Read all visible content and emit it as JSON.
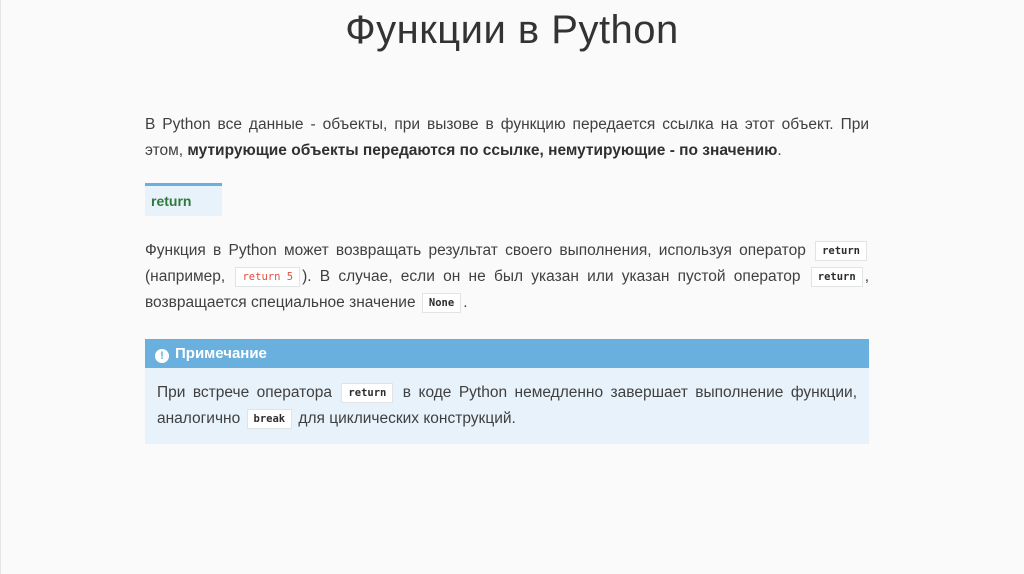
{
  "title": "Функции в Python",
  "intro": {
    "text1": "В Python все данные - объекты, при вызове в функцию передается ссылка на этот объект. При этом, ",
    "bold": "мутирующие объекты передаются по ссылке, немутирующие - по значению",
    "text2": "."
  },
  "return_block": {
    "label": "return"
  },
  "return_desc": {
    "part1": "Функция в Python может возвращать результат своего выполнения, используя оператор ",
    "code1": "return",
    "part2": " (например, ",
    "code2": "return 5",
    "part3": "). В случае, если он не был указан или указан пустой оператор ",
    "code3": "return",
    "part4": ", возвращается специальное значение ",
    "code4": "None",
    "part5": "."
  },
  "note": {
    "icon": "info-icon",
    "icon_glyph": "!",
    "header": "Примечание",
    "part1": "При встрече оператора ",
    "code1": "return",
    "part2": " в коде Python немедленно завершает выполнение функции, аналогично ",
    "code2": "break",
    "part3": " для циклических конструкций."
  },
  "colors": {
    "note_header": "#6ab0de",
    "note_body": "#e7f2fa",
    "return_text": "#2f7a3a",
    "code_red": "#e74c3c"
  }
}
